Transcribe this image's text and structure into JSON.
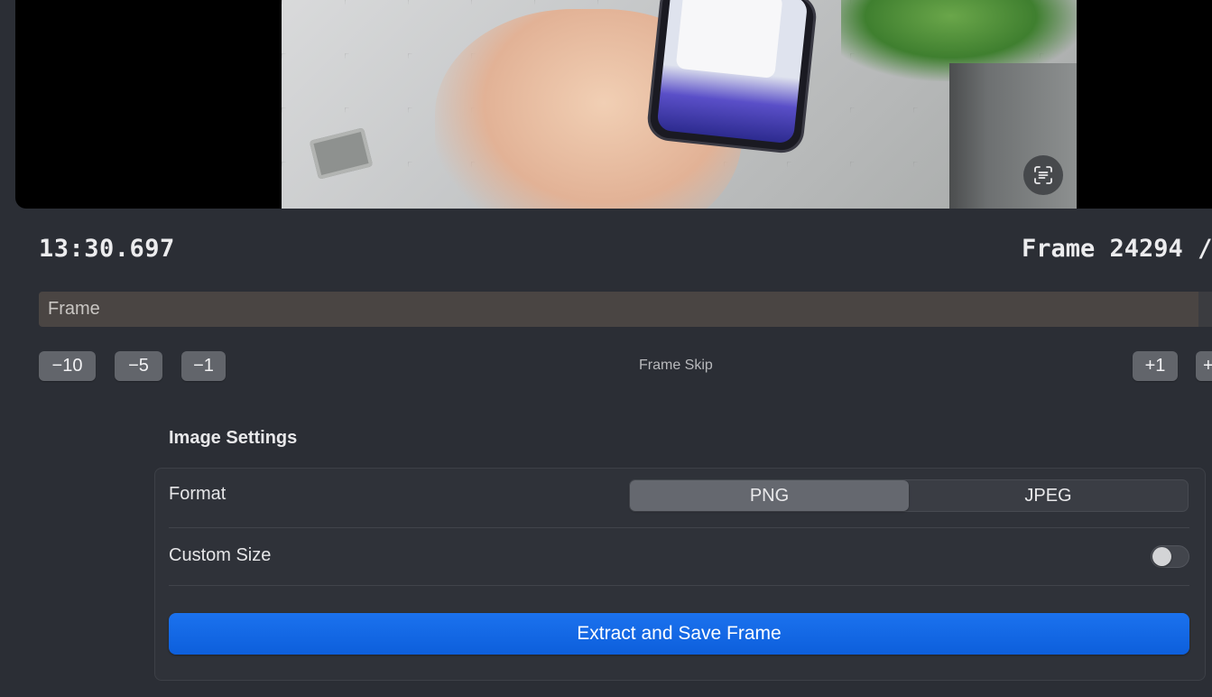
{
  "player": {
    "live_text_icon": "live-text-scan-icon"
  },
  "readout": {
    "timecode": "13:30.697",
    "frame_counter": "Frame 24294 /"
  },
  "frame_field": {
    "placeholder": "Frame"
  },
  "frame_skip": {
    "label": "Frame Skip",
    "back_buttons": [
      "−10",
      "−5",
      "−1"
    ],
    "forward_buttons": [
      "+1",
      "+"
    ]
  },
  "image_settings": {
    "title": "Image Settings",
    "format_label": "Format",
    "format_options": [
      "PNG",
      "JPEG"
    ],
    "format_selected": "PNG",
    "custom_size_label": "Custom Size",
    "custom_size_enabled": false,
    "extract_button": "Extract and Save Frame"
  },
  "colors": {
    "background": "#2b2e35",
    "accent_button": "#1b72ee",
    "field_background": "#4a4543"
  }
}
